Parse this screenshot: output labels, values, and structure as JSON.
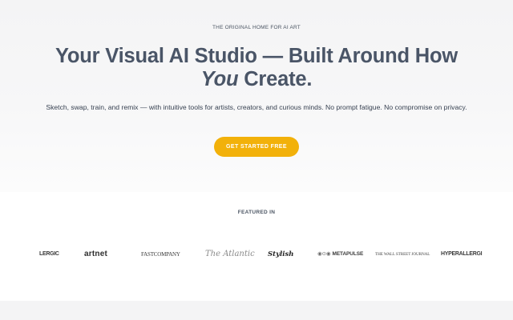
{
  "hero": {
    "eyebrow": "THE ORIGINAL HOME FOR AI ART",
    "headline_line1": "Your Visual AI Studio — Built Around How",
    "headline_emphasis": "You",
    "headline_end": " Create.",
    "subtext": "Sketch, swap, train, and remix — with intuitive tools for artists, creators, and curious minds. No prompt fatigue. No compromise on privacy.",
    "cta_label": "GET STARTED FREE"
  },
  "featured": {
    "title": "FEATURED IN",
    "logos": [
      {
        "name": "hyperallergic",
        "text": "LERGIC"
      },
      {
        "name": "artnet",
        "text": "artnet"
      },
      {
        "name": "fast-company",
        "text": "FASTCOMPANY"
      },
      {
        "name": "the-atlantic",
        "text": "The Atlantic"
      },
      {
        "name": "script-logo",
        "text": "Stylish"
      },
      {
        "name": "metapulse",
        "mark": "◉⊙◉",
        "text": "METAPULSE"
      },
      {
        "name": "wall-street-journal",
        "text": "THE WALL STREET JOURNAL"
      },
      {
        "name": "hyperallergic",
        "text": "HYPERALLERGI"
      }
    ]
  },
  "colors": {
    "headline": "#4a5567",
    "cta_background": "#f2b10a",
    "cta_text": "#ffffff",
    "hero_background": "#f5f5f6"
  }
}
